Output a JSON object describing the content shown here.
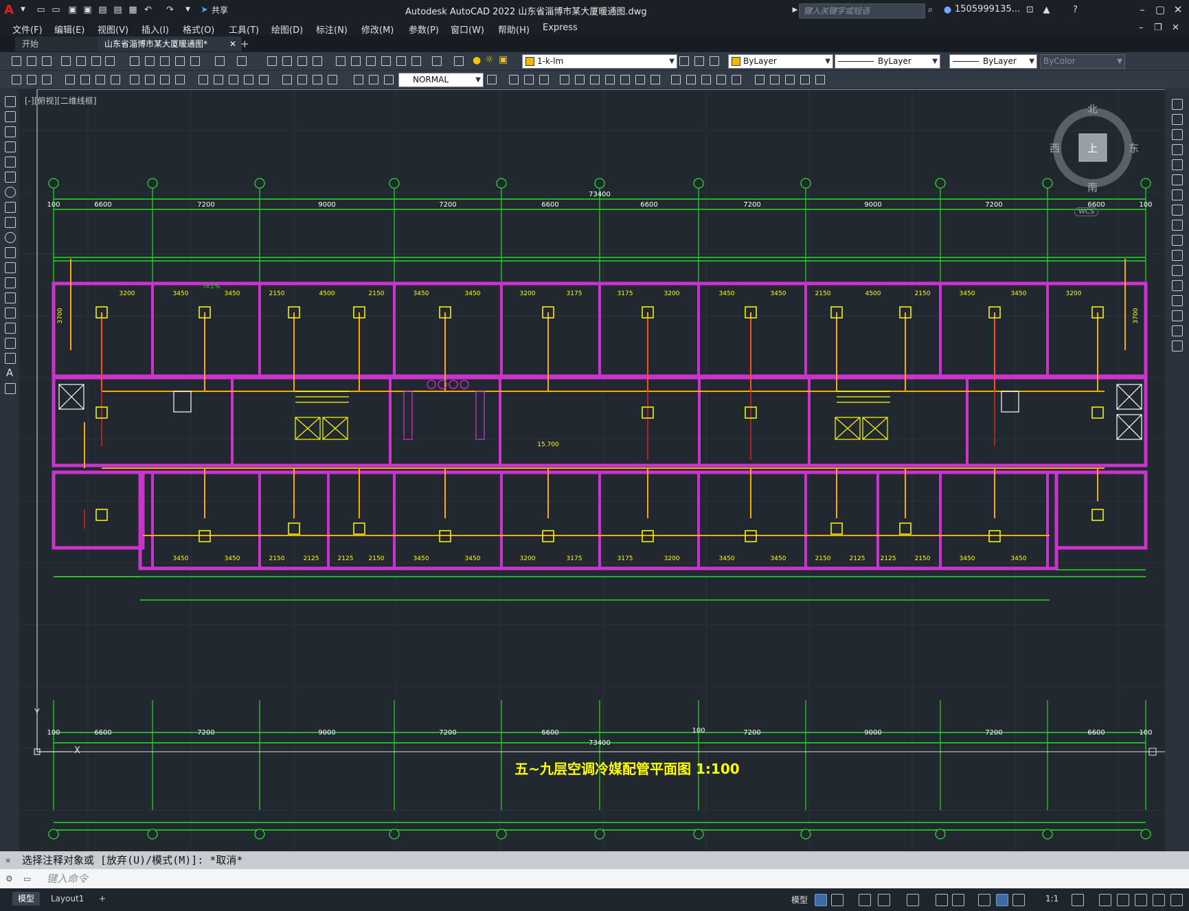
{
  "titlebar": {
    "app_title": "Autodesk AutoCAD 2022    山东省淄博市某大厦暖通图.dwg",
    "share_label": "共享",
    "search_placeholder": "键入关键字或短语",
    "user": "1505999135...",
    "logo": "A"
  },
  "menu": [
    "文件(F)",
    "编辑(E)",
    "视图(V)",
    "插入(I)",
    "格式(O)",
    "工具(T)",
    "绘图(D)",
    "标注(N)",
    "修改(M)",
    "参数(P)",
    "窗口(W)",
    "帮助(H)",
    "Express"
  ],
  "tabs": {
    "start": "开始",
    "drawing": "山东省淄博市某大厦暖通图*",
    "close": "✕",
    "add": "+"
  },
  "layer_combo": "1-k-lm",
  "color_combo": "ByLayer",
  "linetype_combo": "ByLayer",
  "lineweight_combo": "ByLayer",
  "plotstyle_combo": "ByColor",
  "style_combo": "NORMAL",
  "viewport_label": "[-][俯视][二维线框]",
  "viewcube": {
    "north": "北",
    "south": "南",
    "east": "东",
    "west": "西",
    "top": "上",
    "wcs": "WCS"
  },
  "drawing": {
    "title": "五~九层空调冷媒配管平面图 1:100",
    "total_top": "73400",
    "total_bottom": "73400",
    "dims_top": [
      "100",
      "6600",
      "7200",
      "9000",
      "7200",
      "6600",
      "6600",
      "7200",
      "9000",
      "7200",
      "6600",
      "100"
    ],
    "dims_bottom": [
      "100",
      "6600",
      "7200",
      "9000",
      "7200",
      "6600",
      "100",
      "7200",
      "9000",
      "7200",
      "6600",
      "100"
    ],
    "room_dims_top": [
      "3200",
      "3450",
      "3450",
      "2150",
      "4500",
      "2150",
      "3450",
      "3450",
      "3200",
      "3175",
      "3175",
      "3200",
      "3450",
      "3450",
      "2150",
      "4500",
      "2150",
      "3450",
      "3450",
      "3200"
    ],
    "room_dims_bottom": [
      "3450",
      "3450",
      "2150",
      "2125",
      "2125",
      "2150",
      "3450",
      "3450",
      "3200",
      "3175",
      "3175",
      "3200",
      "3450",
      "3450",
      "2150",
      "2125",
      "2125",
      "2150",
      "3450",
      "3450"
    ],
    "elevation": "15.700",
    "slope": "i=1%",
    "vertical_dims": [
      "3700",
      "3700"
    ],
    "axis_x": "X",
    "axis_y": "Y"
  },
  "command": {
    "history": "选择注释对象或 [放弃(U)/模式(M)]: *取消*",
    "placeholder": "键入命令"
  },
  "status": {
    "model_tab": "模型",
    "layout_tab": "Layout1",
    "add_layout": "+",
    "model_btn": "模型",
    "scale": "1:1"
  },
  "colors": {
    "magenta": "#cc33cc",
    "green": "#22dd22",
    "yellow": "#ffff00",
    "orange": "#ffaa00",
    "red": "#ff2020",
    "bg": "#212830"
  }
}
